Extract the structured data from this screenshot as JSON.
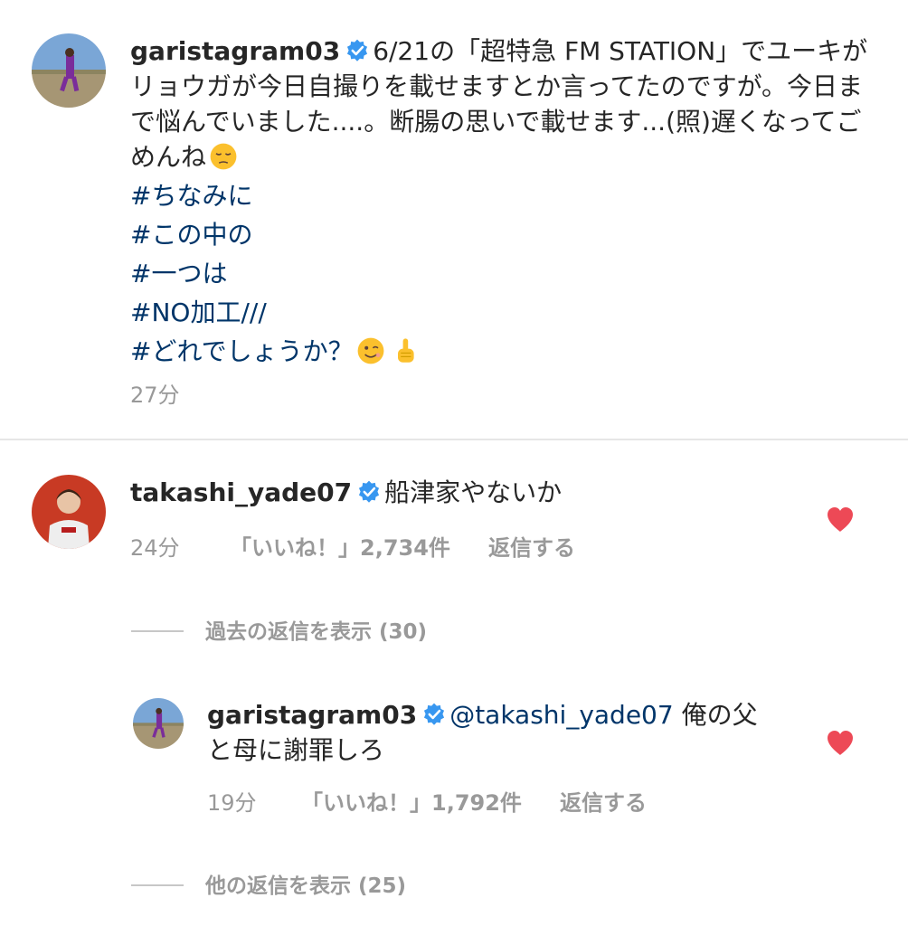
{
  "caption": {
    "username": "garistagram03",
    "text_line1": "6/21の「超特急 FM STATION」でユーキがリョウガが今日自撮りを載せますとか言ってたのですが。今日まで悩んでいました....。断腸の思いで載せます...(照)遅くなってごめんね",
    "hashtags": [
      "#ちなみに",
      "#この中の",
      "#一つは",
      "#NO加工///",
      "#どれでしょうか？"
    ],
    "time": "27分"
  },
  "comments": [
    {
      "username": "takashi_yade07",
      "text": "船津家やないか",
      "time": "24分",
      "likes": "「いいね！」2,734件",
      "reply_label": "返信する"
    }
  ],
  "view_past_replies": "過去の返信を表示 (30)",
  "reply": {
    "username": "garistagram03",
    "mention": "@takashi_yade07",
    "text": "俺の父と母に謝罪しろ",
    "time": "19分",
    "likes": "「いいね！」1,792件",
    "reply_label": "返信する"
  },
  "view_more_replies": "他の返信を表示 (25)",
  "colors": {
    "hashtag": "#003569",
    "verified": "#3897f0",
    "heart": "#ed4956",
    "meta": "#999999",
    "text": "#262626"
  },
  "icons": [
    "verified-badge-icon",
    "pensive-face-emoji",
    "winking-face-emoji",
    "pointing-up-emoji",
    "heart-icon"
  ]
}
